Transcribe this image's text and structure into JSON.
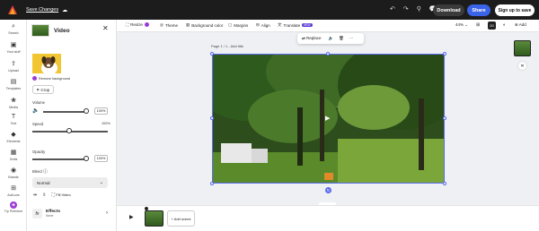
{
  "topbar": {
    "save_status": "Save Changes",
    "download": "Download",
    "share": "Share",
    "signup": "Sign up to save"
  },
  "rail": [
    {
      "icon": "search-icon",
      "label": "Search"
    },
    {
      "icon": "your-stuff-icon",
      "label": "Your stuff"
    },
    {
      "icon": "upload-icon",
      "label": "Upload"
    },
    {
      "icon": "templates-icon",
      "label": "Templates"
    },
    {
      "icon": "media-icon",
      "label": "Media"
    },
    {
      "icon": "text-icon",
      "label": "Text"
    },
    {
      "icon": "elements-icon",
      "label": "Elements"
    },
    {
      "icon": "grids-icon",
      "label": "Grids"
    },
    {
      "icon": "brands-icon",
      "label": "Brands"
    },
    {
      "icon": "add-ons-icon",
      "label": "Add-ons"
    },
    {
      "icon": "premium-icon",
      "label": "Try Premium"
    }
  ],
  "panel": {
    "title": "Video",
    "remove_bg": "Remove background",
    "crop": "Crop",
    "volume_label": "Volume",
    "volume_value": "100%",
    "speed_label": "Speed",
    "speed_value": "100%",
    "opacity_label": "Opacity",
    "opacity_value": "100%",
    "blend_label": "Blend",
    "blend_value": "Normal",
    "fill_video": "Fill Video",
    "effects_title": "Effects",
    "effects_sub": "None"
  },
  "toolbar": {
    "resize": "Resize",
    "theme": "Theme",
    "background_color": "Background color",
    "margins": "Margins",
    "align": "Align",
    "translate": "Translate",
    "translate_badge": "NEW",
    "zoom": "44%",
    "page_count": "20",
    "add": "Add"
  },
  "canvas": {
    "page_label": "Page 1 / 1 - Add title",
    "replace": "Replace"
  },
  "timeline": {
    "add_scene": "+ Add scene"
  }
}
